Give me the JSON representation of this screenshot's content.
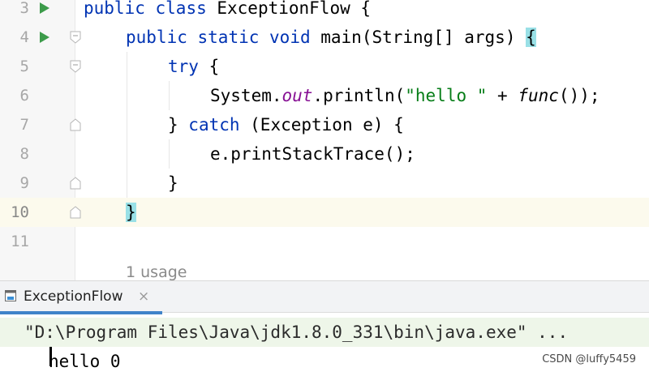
{
  "editor": {
    "lines": [
      {
        "num": "3"
      },
      {
        "num": "4"
      },
      {
        "num": "5"
      },
      {
        "num": "6"
      },
      {
        "num": "7"
      },
      {
        "num": "8"
      },
      {
        "num": "9"
      },
      {
        "num": "10"
      },
      {
        "num": "11"
      }
    ],
    "code": {
      "l3": {
        "kw1": "public",
        "kw2": "class",
        "rest": " ExceptionFlow {"
      },
      "l4": {
        "kw1": "public",
        "kw2": "static",
        "kw3": "void",
        "rest": " main(String[] args) ",
        "brace": "{"
      },
      "l5": {
        "kw": "try",
        "rest": " {"
      },
      "l6": {
        "pre": "System.",
        "field": "out",
        "mid": ".println(",
        "str": "\"hello \"",
        "plus": " + ",
        "call": "func",
        "end": "());"
      },
      "l7": {
        "pre": "} ",
        "kw": "catch",
        "rest": " (Exception e) {"
      },
      "l8": {
        "text": "e.printStackTrace();"
      },
      "l9": {
        "text": "}"
      },
      "l10": {
        "brace": "}"
      }
    },
    "usage_hint": "1 usage"
  },
  "run_panel": {
    "tab_label": "ExceptionFlow",
    "tab_close": "×",
    "output": {
      "command": "\"D:\\Program Files\\Java\\jdk1.8.0_331\\bin\\java.exe\" ...",
      "result": "hello 0"
    }
  },
  "watermark": "CSDN @luffy5459",
  "colors": {
    "keyword": "#0033b3",
    "field": "#871094",
    "string": "#067d17",
    "run_icon": "#3c9b4a",
    "brace_highlight": "#99e0e6",
    "tab_underline": "#4083c9"
  }
}
